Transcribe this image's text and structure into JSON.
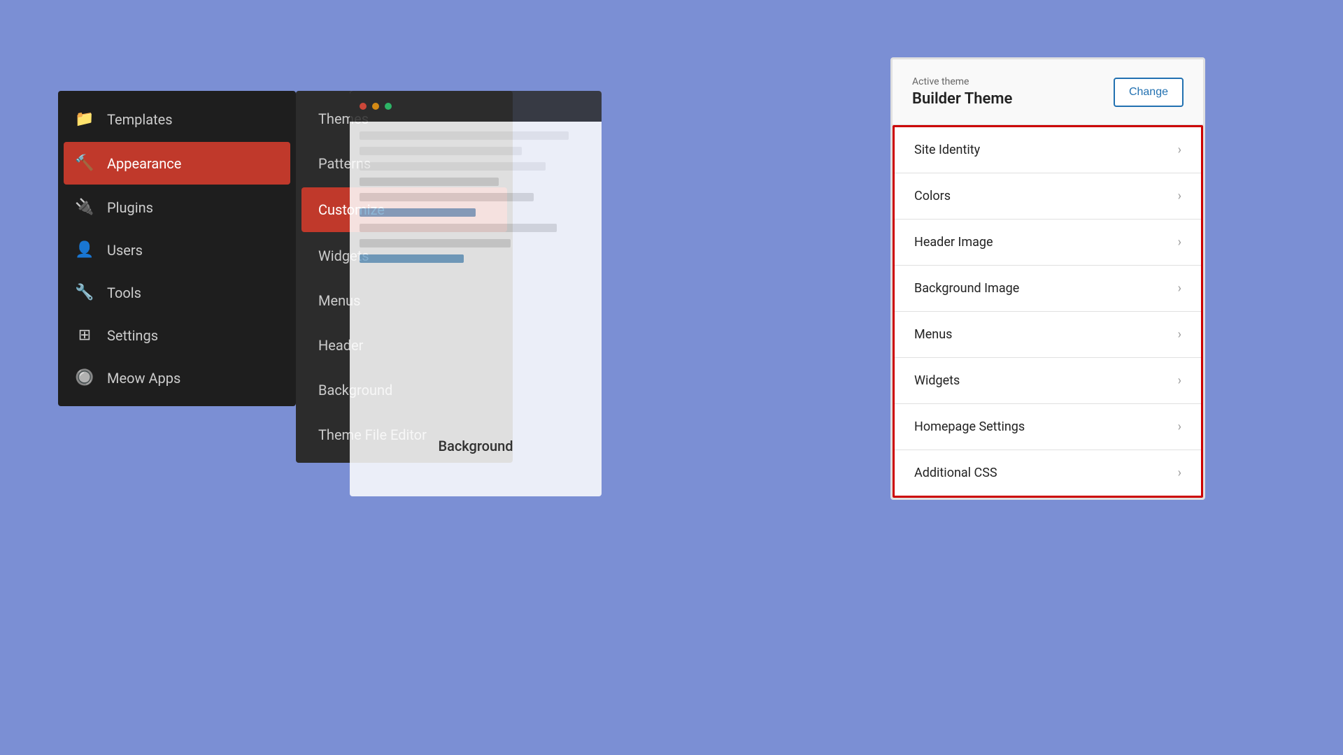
{
  "sidebar": {
    "items": [
      {
        "id": "templates",
        "label": "Templates",
        "icon": "📁",
        "active": false
      },
      {
        "id": "appearance",
        "label": "Appearance",
        "icon": "🔨",
        "active": true
      },
      {
        "id": "plugins",
        "label": "Plugins",
        "icon": "🔌",
        "active": false
      },
      {
        "id": "users",
        "label": "Users",
        "icon": "👤",
        "active": false
      },
      {
        "id": "tools",
        "label": "Tools",
        "icon": "🔧",
        "active": false
      },
      {
        "id": "settings",
        "label": "Settings",
        "icon": "⚙",
        "active": false
      },
      {
        "id": "meow-apps",
        "label": "Meow Apps",
        "icon": "🔘",
        "active": false
      }
    ]
  },
  "submenu": {
    "items": [
      {
        "id": "themes",
        "label": "Themes",
        "active": false
      },
      {
        "id": "patterns",
        "label": "Patterns",
        "active": false
      },
      {
        "id": "customize",
        "label": "Customize",
        "active": true
      },
      {
        "id": "widgets",
        "label": "Widgets",
        "active": false
      },
      {
        "id": "menus",
        "label": "Menus",
        "active": false
      },
      {
        "id": "header",
        "label": "Header",
        "active": false
      },
      {
        "id": "background",
        "label": "Background",
        "active": false
      },
      {
        "id": "theme-file-editor",
        "label": "Theme File Editor",
        "active": false
      }
    ]
  },
  "customizer": {
    "active_theme_label": "Active theme",
    "theme_name": "Builder Theme",
    "change_button_label": "Change",
    "menu_items": [
      {
        "id": "site-identity",
        "label": "Site Identity"
      },
      {
        "id": "colors",
        "label": "Colors"
      },
      {
        "id": "header-image",
        "label": "Header Image"
      },
      {
        "id": "background-image",
        "label": "Background Image"
      },
      {
        "id": "menus",
        "label": "Menus"
      },
      {
        "id": "widgets",
        "label": "Widgets"
      },
      {
        "id": "homepage-settings",
        "label": "Homepage Settings"
      },
      {
        "id": "additional-css",
        "label": "Additional CSS"
      }
    ]
  },
  "background_label": "Background",
  "page_background_color": "#7b8fd4"
}
